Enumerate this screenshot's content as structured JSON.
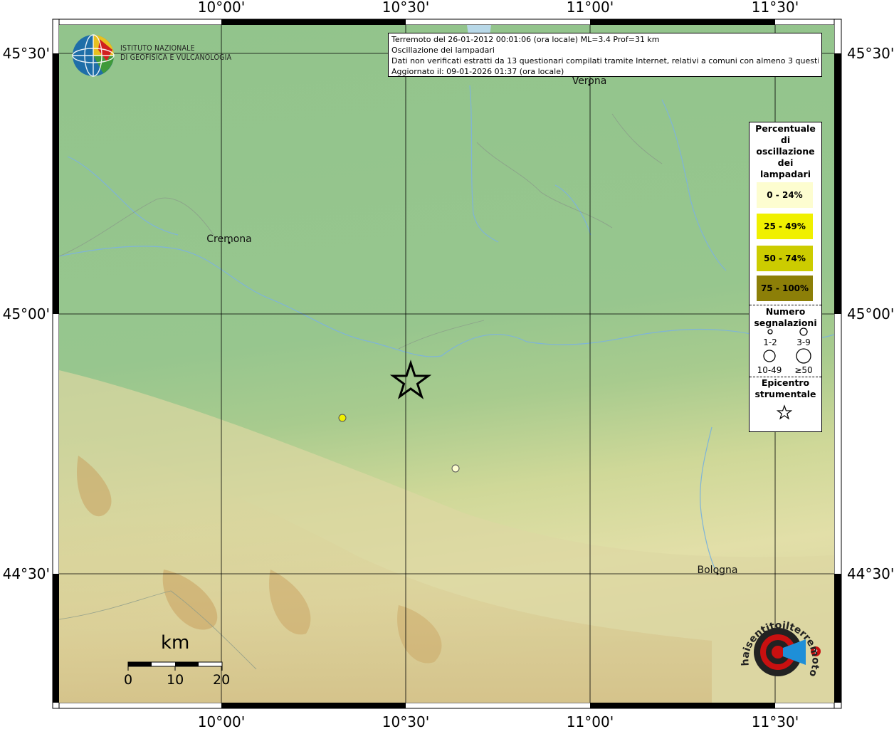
{
  "header": {
    "line1": "Terremoto del 26-01-2012 00:01:06 (ora locale) ML=3.4 Prof=31 km",
    "line2": "Oscillazione dei lampadari",
    "line3": "Dati non verificati estratti da 13 questionari compilati tramite Internet, relativi a comuni con almeno 3 questionari.",
    "line4": "Aggiornato il: 09-01-2026 01:37 (ora locale)"
  },
  "logo": {
    "line1": "ISTITUTO NAZIONALE",
    "line2": "DI GEOFISICA E VULCANOLOGIA"
  },
  "axes": {
    "top_ticks": [
      "10°00'",
      "10°30'",
      "11°00'",
      "11°30'"
    ],
    "bottom_ticks": [
      "10°00'",
      "10°30'",
      "11°00'",
      "11°30'"
    ],
    "left_ticks": [
      "45°30'",
      "45°00'",
      "44°30'"
    ],
    "right_ticks": [
      "45°30'",
      "45°00'",
      "44°30'"
    ]
  },
  "cities": [
    {
      "name": "Verona"
    },
    {
      "name": "Cremona"
    },
    {
      "name": "Bologna"
    }
  ],
  "legend": {
    "title_lines": [
      "Percentuale",
      "di",
      "oscillazione",
      "dei",
      "lampadari"
    ],
    "classes": [
      {
        "label": "0 - 24%",
        "color": "#fdfdd0"
      },
      {
        "label": "25 - 49%",
        "color": "#f0f000"
      },
      {
        "label": "50 - 74%",
        "color": "#cccc00"
      },
      {
        "label": "75 - 100%",
        "color": "#8c7f08"
      }
    ],
    "count_title_lines": [
      "Numero",
      "segnalazioni"
    ],
    "count_classes": [
      "1-2",
      "3-9",
      "10-49",
      "≥50"
    ],
    "epicenter_title_lines": [
      "Epicentro",
      "strumentale"
    ]
  },
  "scalebar": {
    "unit": "km",
    "labels": [
      "0",
      "10",
      "20"
    ]
  },
  "watermark": {
    "text": "haisentitoilterremoto.it"
  },
  "points": [
    {
      "class": "25 - 49%",
      "color": "#f0f000"
    },
    {
      "class": "0 - 24%",
      "color": "#fdfdd0"
    }
  ]
}
